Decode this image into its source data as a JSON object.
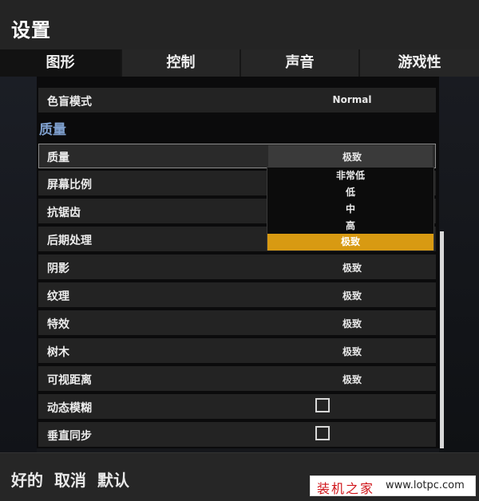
{
  "window": {
    "title": "设置"
  },
  "tabs": [
    {
      "label": "图形",
      "active": true
    },
    {
      "label": "控制",
      "active": false
    },
    {
      "label": "声音",
      "active": false
    },
    {
      "label": "游戏性",
      "active": false
    }
  ],
  "graphics": {
    "colorblind": {
      "label": "色盲模式",
      "value": "Normal"
    },
    "section_quality": "质量",
    "quality": {
      "label": "质量",
      "value": "极致"
    },
    "rows": [
      {
        "label": "屏幕比例",
        "value": ""
      },
      {
        "label": "抗锯齿",
        "value": ""
      },
      {
        "label": "后期处理",
        "value": ""
      },
      {
        "label": "阴影",
        "value": "极致"
      },
      {
        "label": "纹理",
        "value": "极致"
      },
      {
        "label": "特效",
        "value": "极致"
      },
      {
        "label": "树木",
        "value": "极致"
      },
      {
        "label": "可视距离",
        "value": "极致"
      }
    ],
    "motion_blur": {
      "label": "动态模糊",
      "checked": false
    },
    "vsync": {
      "label": "垂直同步",
      "checked": false
    }
  },
  "quality_dropdown": {
    "options": [
      "非常低",
      "低",
      "中",
      "高",
      "极致"
    ],
    "selected": "极致",
    "highlight_color": "#d89a12"
  },
  "footer": {
    "ok": "好的",
    "cancel": "取消",
    "default": "默认"
  },
  "watermark": {
    "brand": "装机之家",
    "url": "www.lotpc.com"
  },
  "colors": {
    "section_header": "#7fa0cf",
    "background": "#15171b"
  }
}
